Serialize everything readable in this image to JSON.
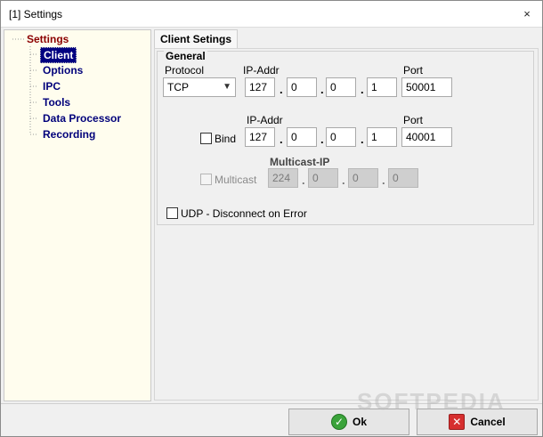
{
  "window": {
    "title": "[1] Settings",
    "close_glyph": "×"
  },
  "tree": {
    "root": "Settings",
    "items": [
      {
        "label": "Client",
        "selected": true
      },
      {
        "label": "Options",
        "selected": false
      },
      {
        "label": "IPC",
        "selected": false
      },
      {
        "label": "Tools",
        "selected": false
      },
      {
        "label": "Data Processor",
        "selected": false
      },
      {
        "label": "Recording",
        "selected": false
      }
    ]
  },
  "tab": {
    "label": "Client Setings"
  },
  "general": {
    "label": "General",
    "protocol_label": "Protocol",
    "protocol_value": "TCP",
    "ip_label": "IP-Addr",
    "port_label": "Port",
    "ip": [
      "127",
      "0",
      "0",
      "1"
    ],
    "port": "50001",
    "bind": {
      "checkbox_label": "Bind",
      "checked": false,
      "ip_label": "IP-Addr",
      "port_label": "Port",
      "ip": [
        "127",
        "0",
        "0",
        "1"
      ],
      "port": "40001"
    },
    "multicast": {
      "checkbox_label": "Multicast",
      "checked": false,
      "enabled": false,
      "ip_label": "Multicast-IP",
      "ip": [
        "224",
        "0",
        "0",
        "0"
      ]
    },
    "udp": {
      "checkbox_label": "UDP - Disconnect on Error",
      "checked": false
    }
  },
  "buttons": {
    "ok": "Ok",
    "cancel": "Cancel"
  },
  "watermark": "SOFTPEDIA",
  "colors": {
    "tree_bg": "#fffdee",
    "root_color": "#8b0000",
    "item_color": "#00007a",
    "selected_bg": "#000080"
  }
}
